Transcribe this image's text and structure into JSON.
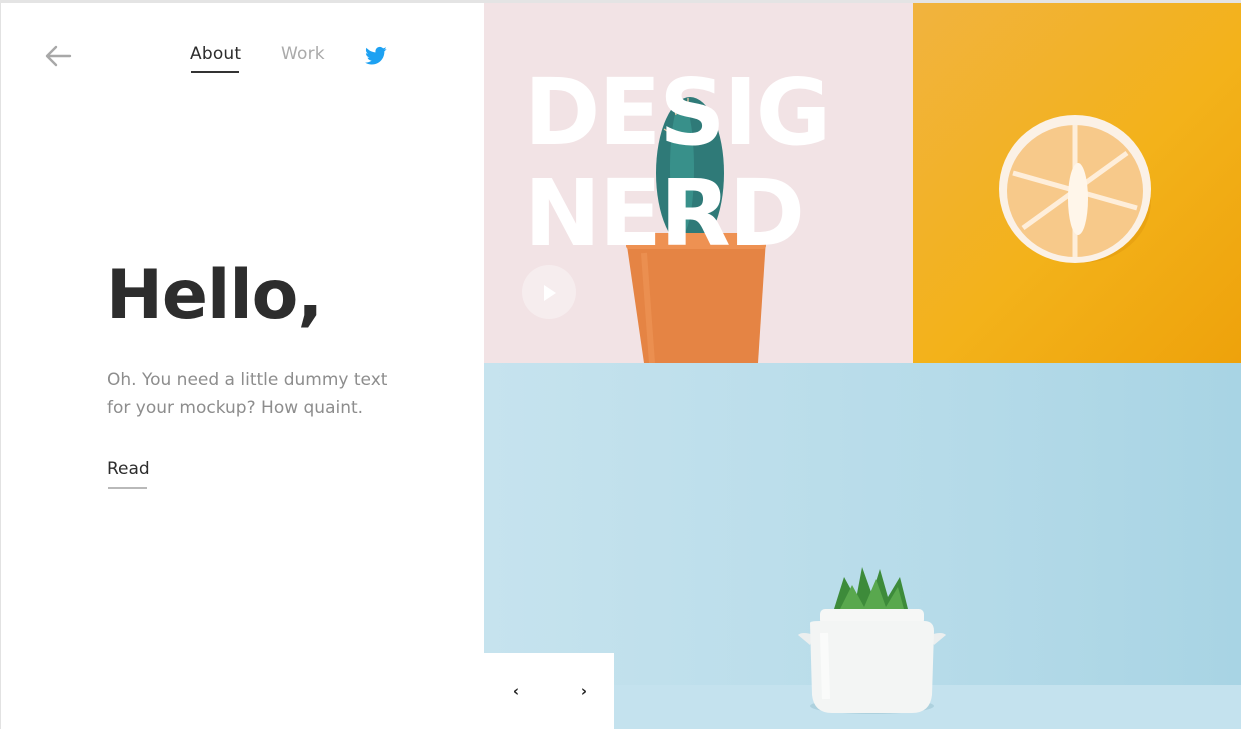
{
  "nav": {
    "back_icon": "arrow-left-icon",
    "about": "About",
    "work": "Work",
    "twitter_icon": "twitter-icon"
  },
  "hero": {
    "title": "Hello,",
    "lead_line1": "Oh. You need a little dummy text",
    "lead_line2": "for your mockup? How quaint.",
    "read_label": "Read"
  },
  "tiles": {
    "feature_line1": "DESIG",
    "feature_line2": "NERD",
    "play_icon": "play-icon"
  },
  "pager": {
    "prev": "‹",
    "next": "›"
  },
  "colors": {
    "pink": "#f2e3e5",
    "yellow": "#f3b21a",
    "blue": "#b6dbe9",
    "twitter": "#1da1f2",
    "text_dark": "#2d2d2d",
    "text_muted": "#8d8d8d"
  }
}
